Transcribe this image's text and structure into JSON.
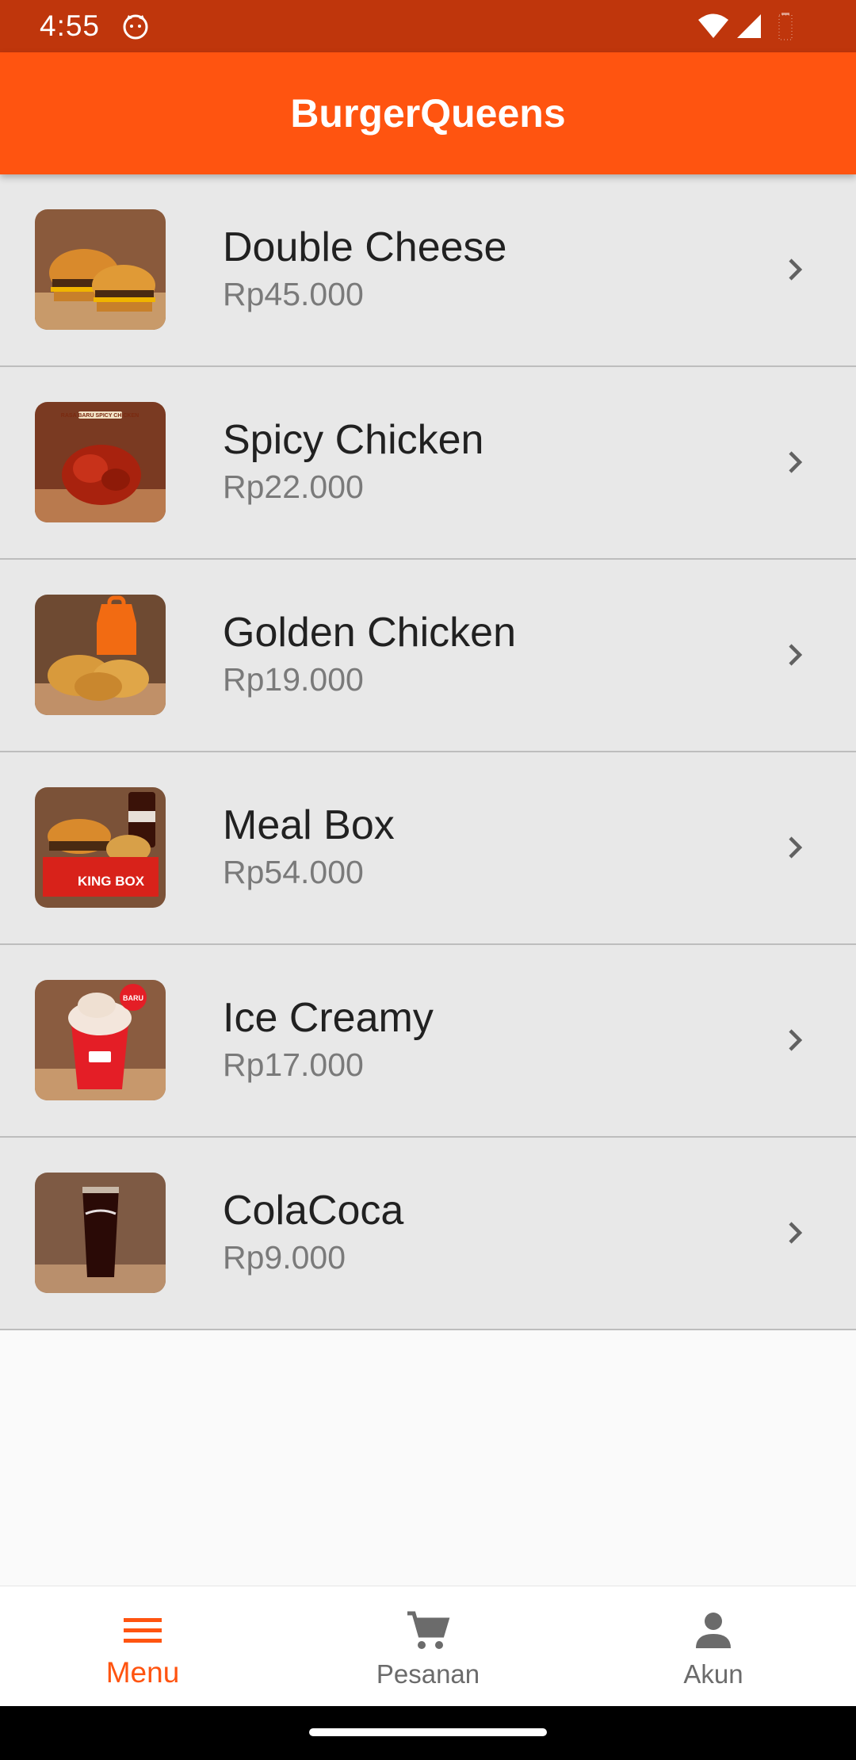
{
  "status_bar": {
    "time": "4:55",
    "icons": [
      "cat-notification-icon",
      "wifi-icon",
      "signal-icon",
      "battery-icon"
    ]
  },
  "app_bar": {
    "title": "BurgerQueens",
    "color": "#ff5410"
  },
  "menu": {
    "items": [
      {
        "name": "Double Cheese",
        "price": "Rp45.000",
        "image": "double-cheeseburger-image"
      },
      {
        "name": "Spicy Chicken",
        "price": "Rp22.000",
        "image": "spicy-chicken-image",
        "image_text": "RASA BARU SPICY CHICKEN"
      },
      {
        "name": "Golden Chicken",
        "price": "Rp19.000",
        "image": "fried-chicken-image"
      },
      {
        "name": "Meal Box",
        "price": "Rp54.000",
        "image": "meal-box-image",
        "image_text": "KING BOX"
      },
      {
        "name": "Ice Creamy",
        "price": "Rp17.000",
        "image": "ice-cream-image",
        "image_text": "BARU"
      },
      {
        "name": "ColaCoca",
        "price": "Rp9.000",
        "image": "cola-glass-image"
      }
    ]
  },
  "bottom_nav": {
    "items": [
      {
        "label": "Menu",
        "icon": "hamburger-menu-icon",
        "active": true
      },
      {
        "label": "Pesanan",
        "icon": "cart-icon",
        "active": false
      },
      {
        "label": "Akun",
        "icon": "person-icon",
        "active": false
      }
    ],
    "active_color": "#ff5410"
  }
}
